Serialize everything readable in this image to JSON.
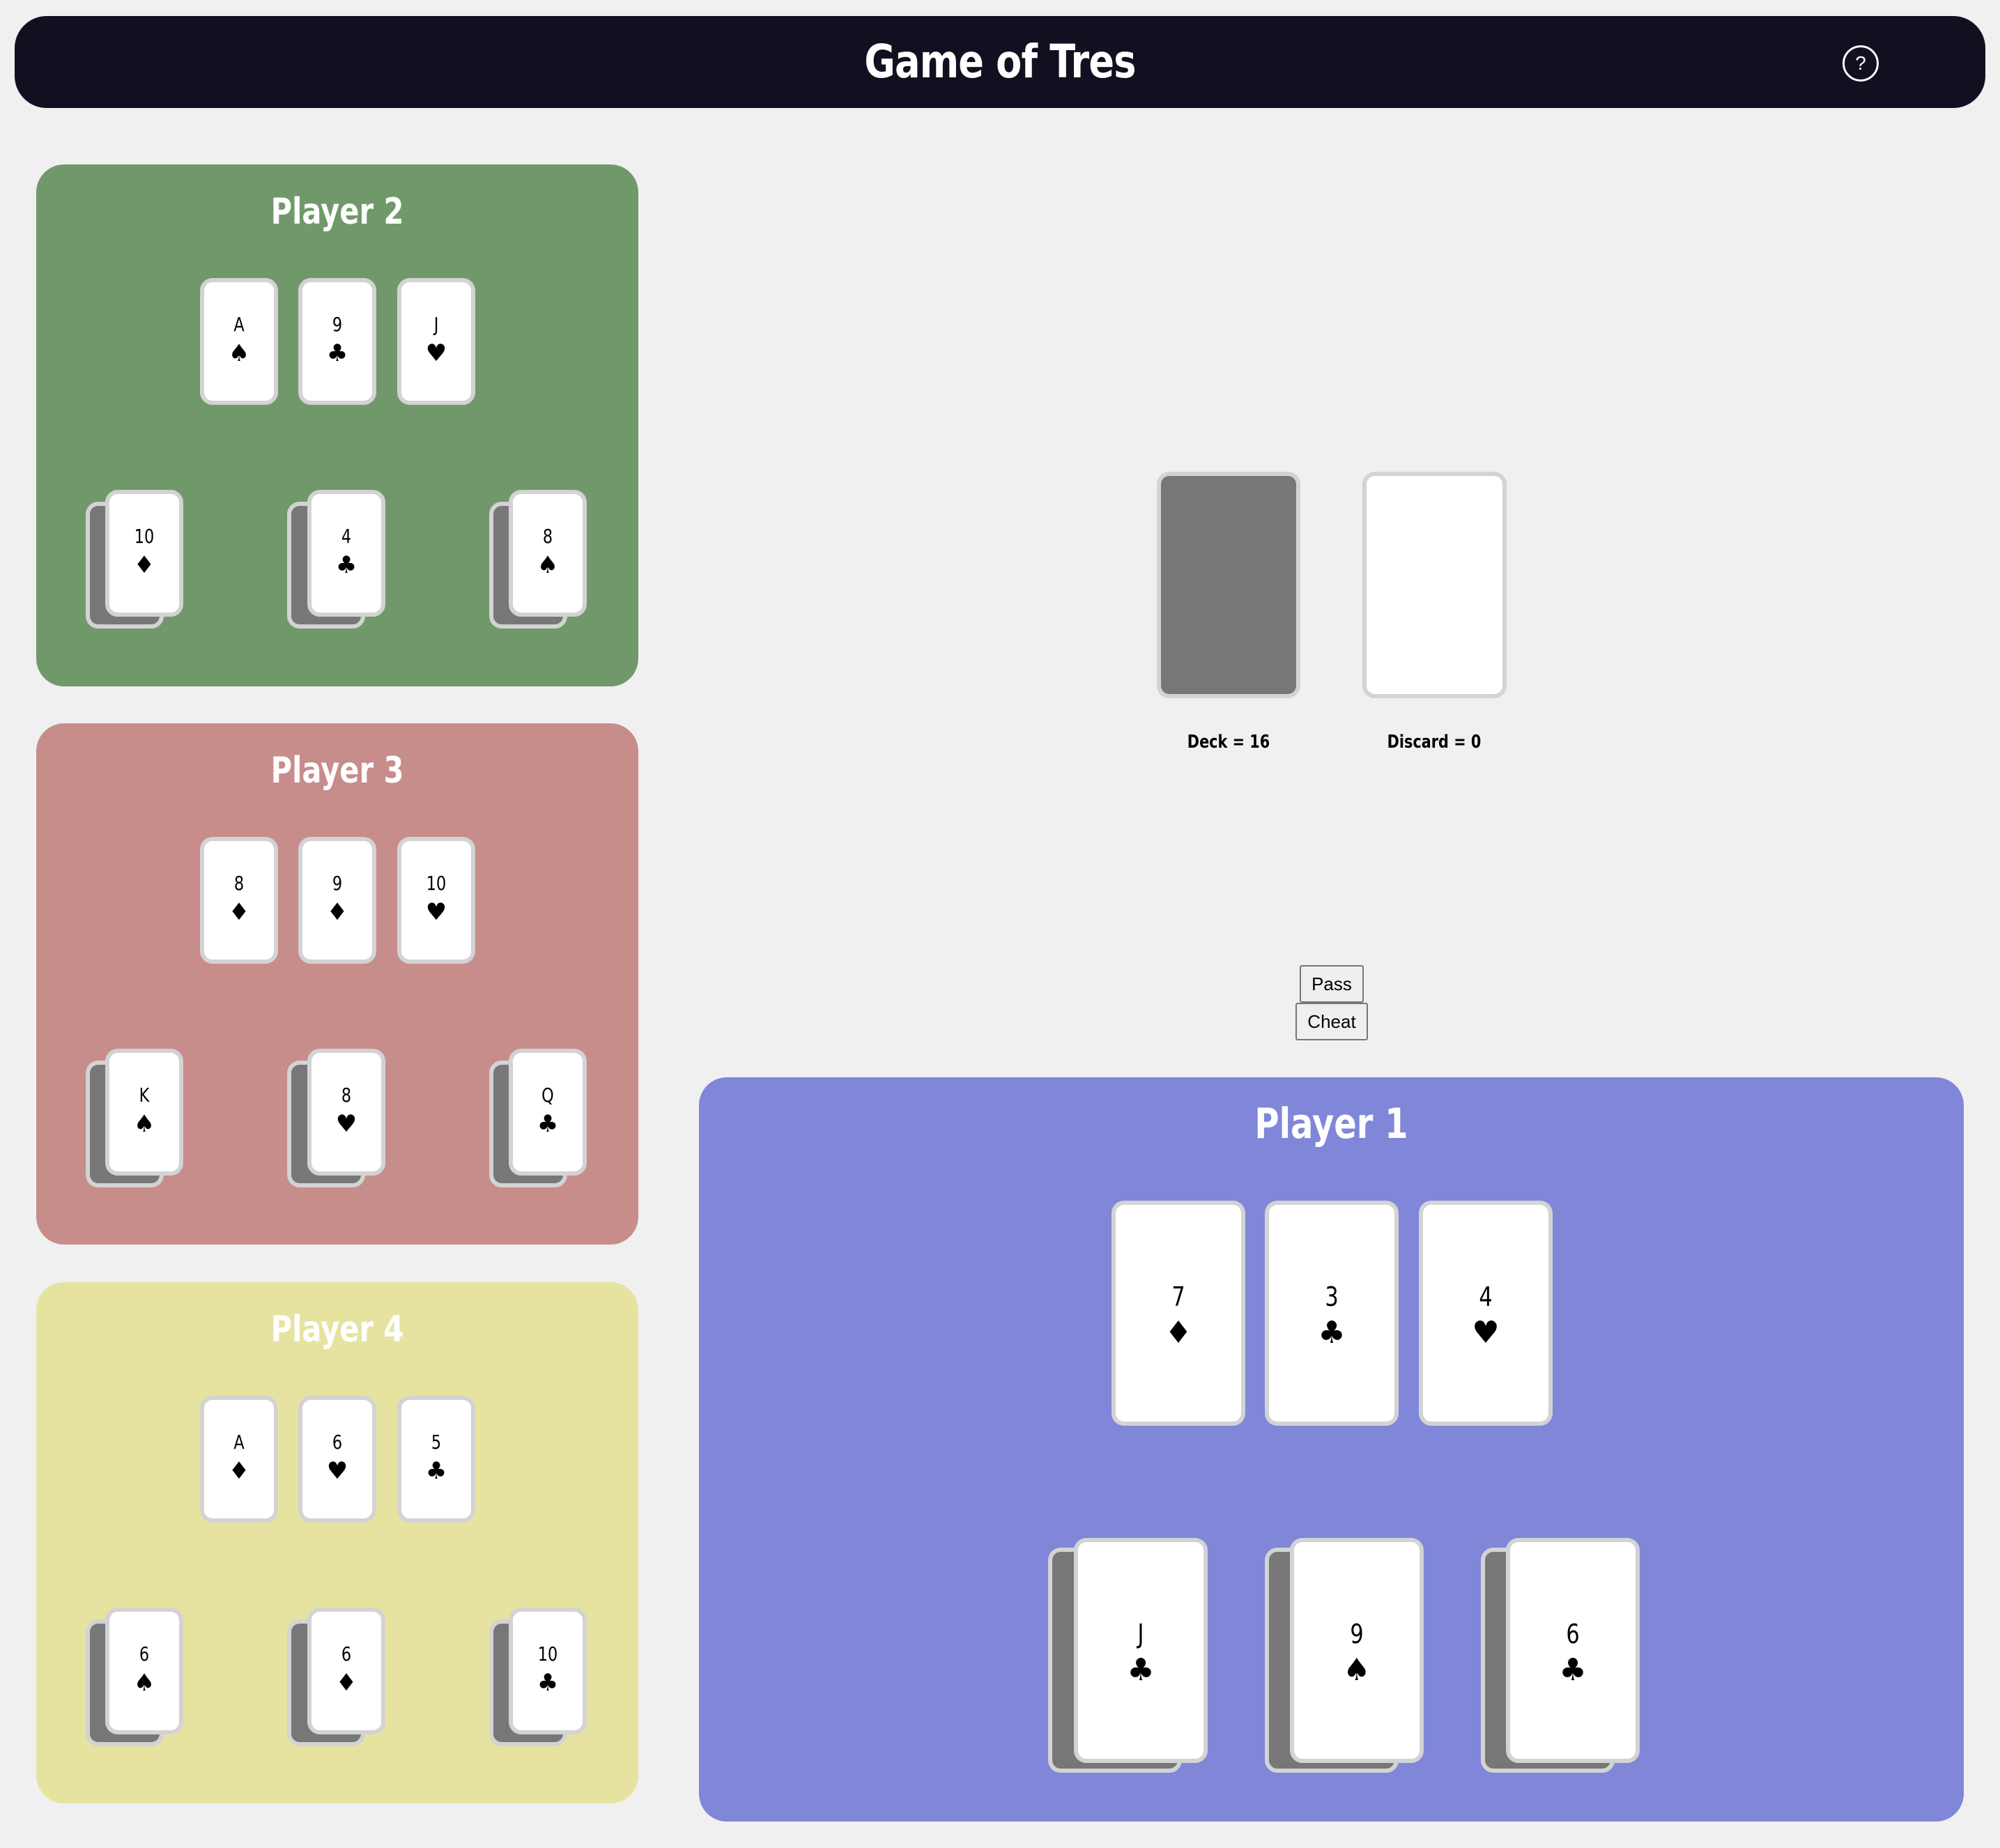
{
  "header": {
    "title": "Game of Tres",
    "help_label": "?"
  },
  "pile": {
    "deck_label": "Deck = 16",
    "discard_label": "Discard = 0"
  },
  "actions": {
    "pass_label": "Pass",
    "cheat_label": "Cheat"
  },
  "players": [
    {
      "name": "Player 2",
      "color": "#71986b",
      "hand": [
        {
          "rank": "A",
          "suit": "♠"
        },
        {
          "rank": "9",
          "suit": "♣"
        },
        {
          "rank": "J",
          "suit": "♥"
        }
      ],
      "table": [
        {
          "rank": "10",
          "suit": "♦"
        },
        {
          "rank": "4",
          "suit": "♣"
        },
        {
          "rank": "8",
          "suit": "♠"
        }
      ]
    },
    {
      "name": "Player 3",
      "color": "#c78d8b",
      "hand": [
        {
          "rank": "8",
          "suit": "♦"
        },
        {
          "rank": "9",
          "suit": "♦"
        },
        {
          "rank": "10",
          "suit": "♥"
        }
      ],
      "table": [
        {
          "rank": "K",
          "suit": "♠"
        },
        {
          "rank": "8",
          "suit": "♥"
        },
        {
          "rank": "Q",
          "suit": "♣"
        }
      ]
    },
    {
      "name": "Player 4",
      "color": "#e6e3a1",
      "hand": [
        {
          "rank": "A",
          "suit": "♦"
        },
        {
          "rank": "6",
          "suit": "♥"
        },
        {
          "rank": "5",
          "suit": "♣"
        }
      ],
      "table": [
        {
          "rank": "6",
          "suit": "♠"
        },
        {
          "rank": "6",
          "suit": "♦"
        },
        {
          "rank": "10",
          "suit": "♣"
        }
      ]
    },
    {
      "name": "Player 1",
      "color": "#8087d8",
      "hand": [
        {
          "rank": "7",
          "suit": "♦"
        },
        {
          "rank": "3",
          "suit": "♣"
        },
        {
          "rank": "4",
          "suit": "♥"
        }
      ],
      "table": [
        {
          "rank": "J",
          "suit": "♣"
        },
        {
          "rank": "9",
          "suit": "♠"
        },
        {
          "rank": "6",
          "suit": "♣"
        }
      ]
    }
  ]
}
